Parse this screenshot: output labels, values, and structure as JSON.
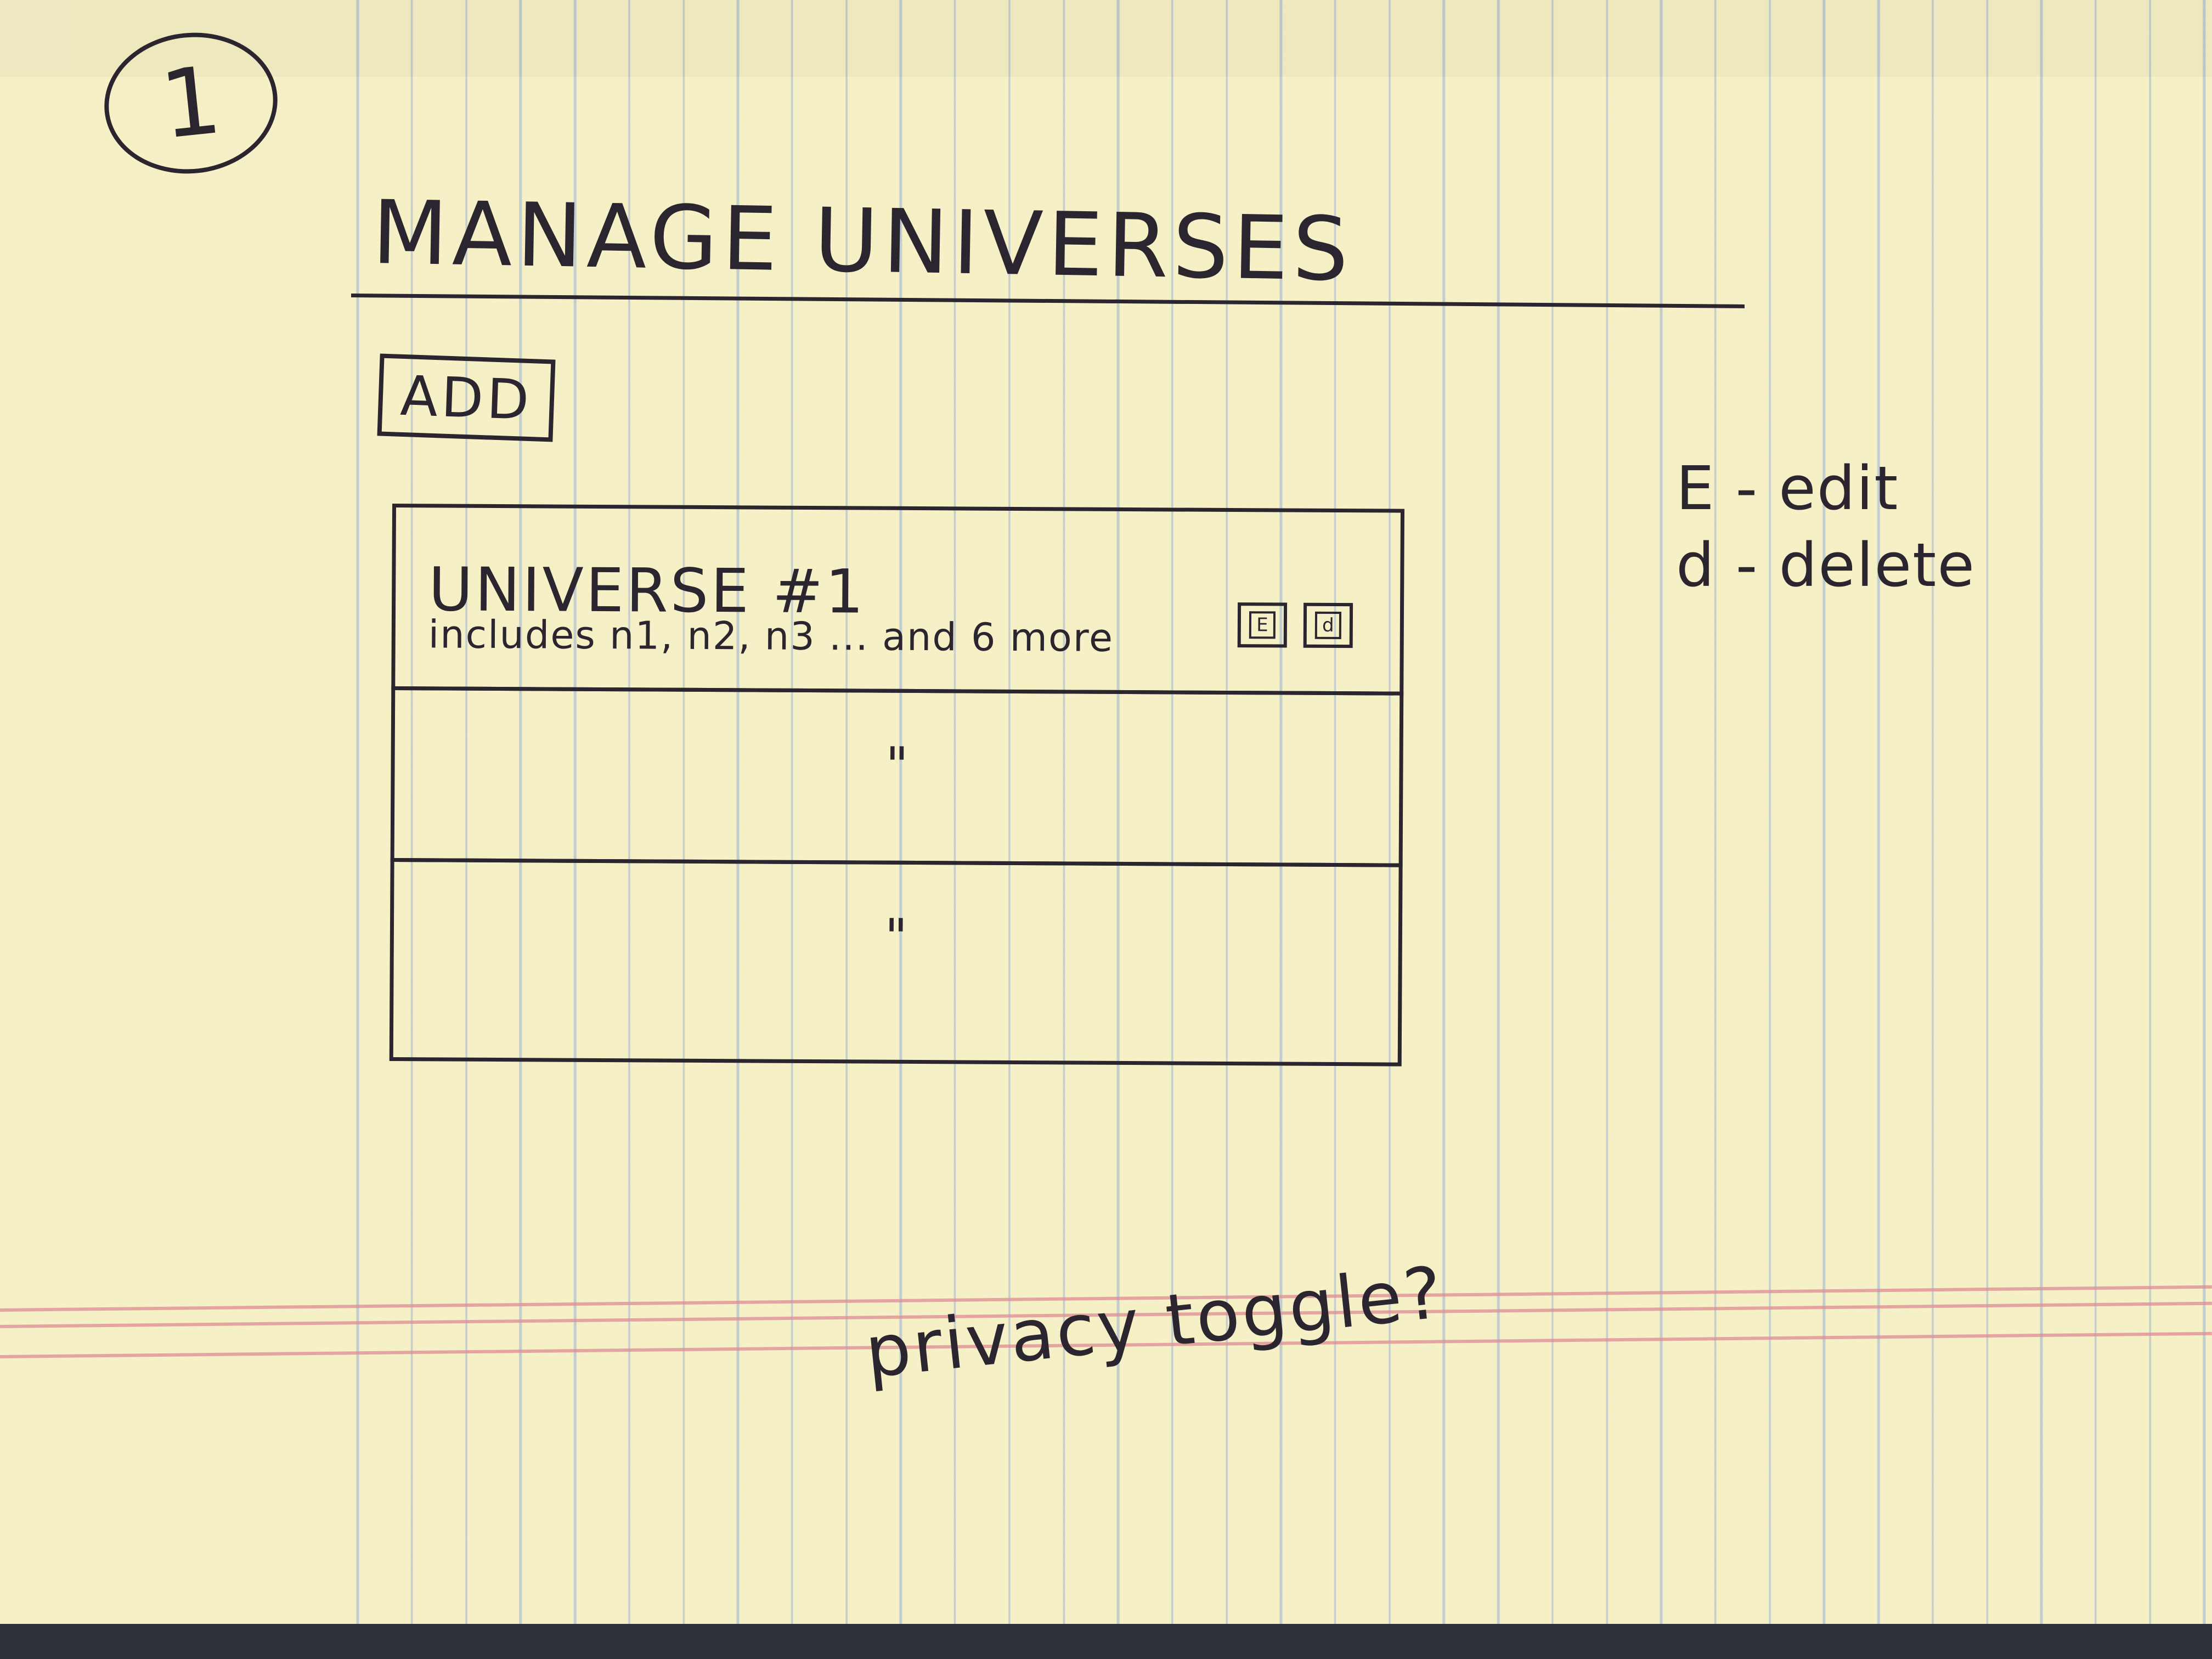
{
  "page_number": "1",
  "title": "MANAGE UNIVERSES",
  "add_button": {
    "label": "ADD"
  },
  "universes": [
    {
      "name": "UNIVERSE #1",
      "subtitle": "includes n1, n2, n3 ... and 6 more",
      "edit_label": "E",
      "delete_label": "d"
    },
    {
      "ditto": "\""
    },
    {
      "ditto": "\""
    }
  ],
  "legend": [
    {
      "text": "E - edit"
    },
    {
      "text": "d - delete"
    }
  ],
  "note": "privacy toggle?",
  "colors": {
    "paper": "#f6f0c6",
    "ink": "#2b2530",
    "rule_lines": "#96afd7",
    "margin_lines": "#de8c96"
  }
}
